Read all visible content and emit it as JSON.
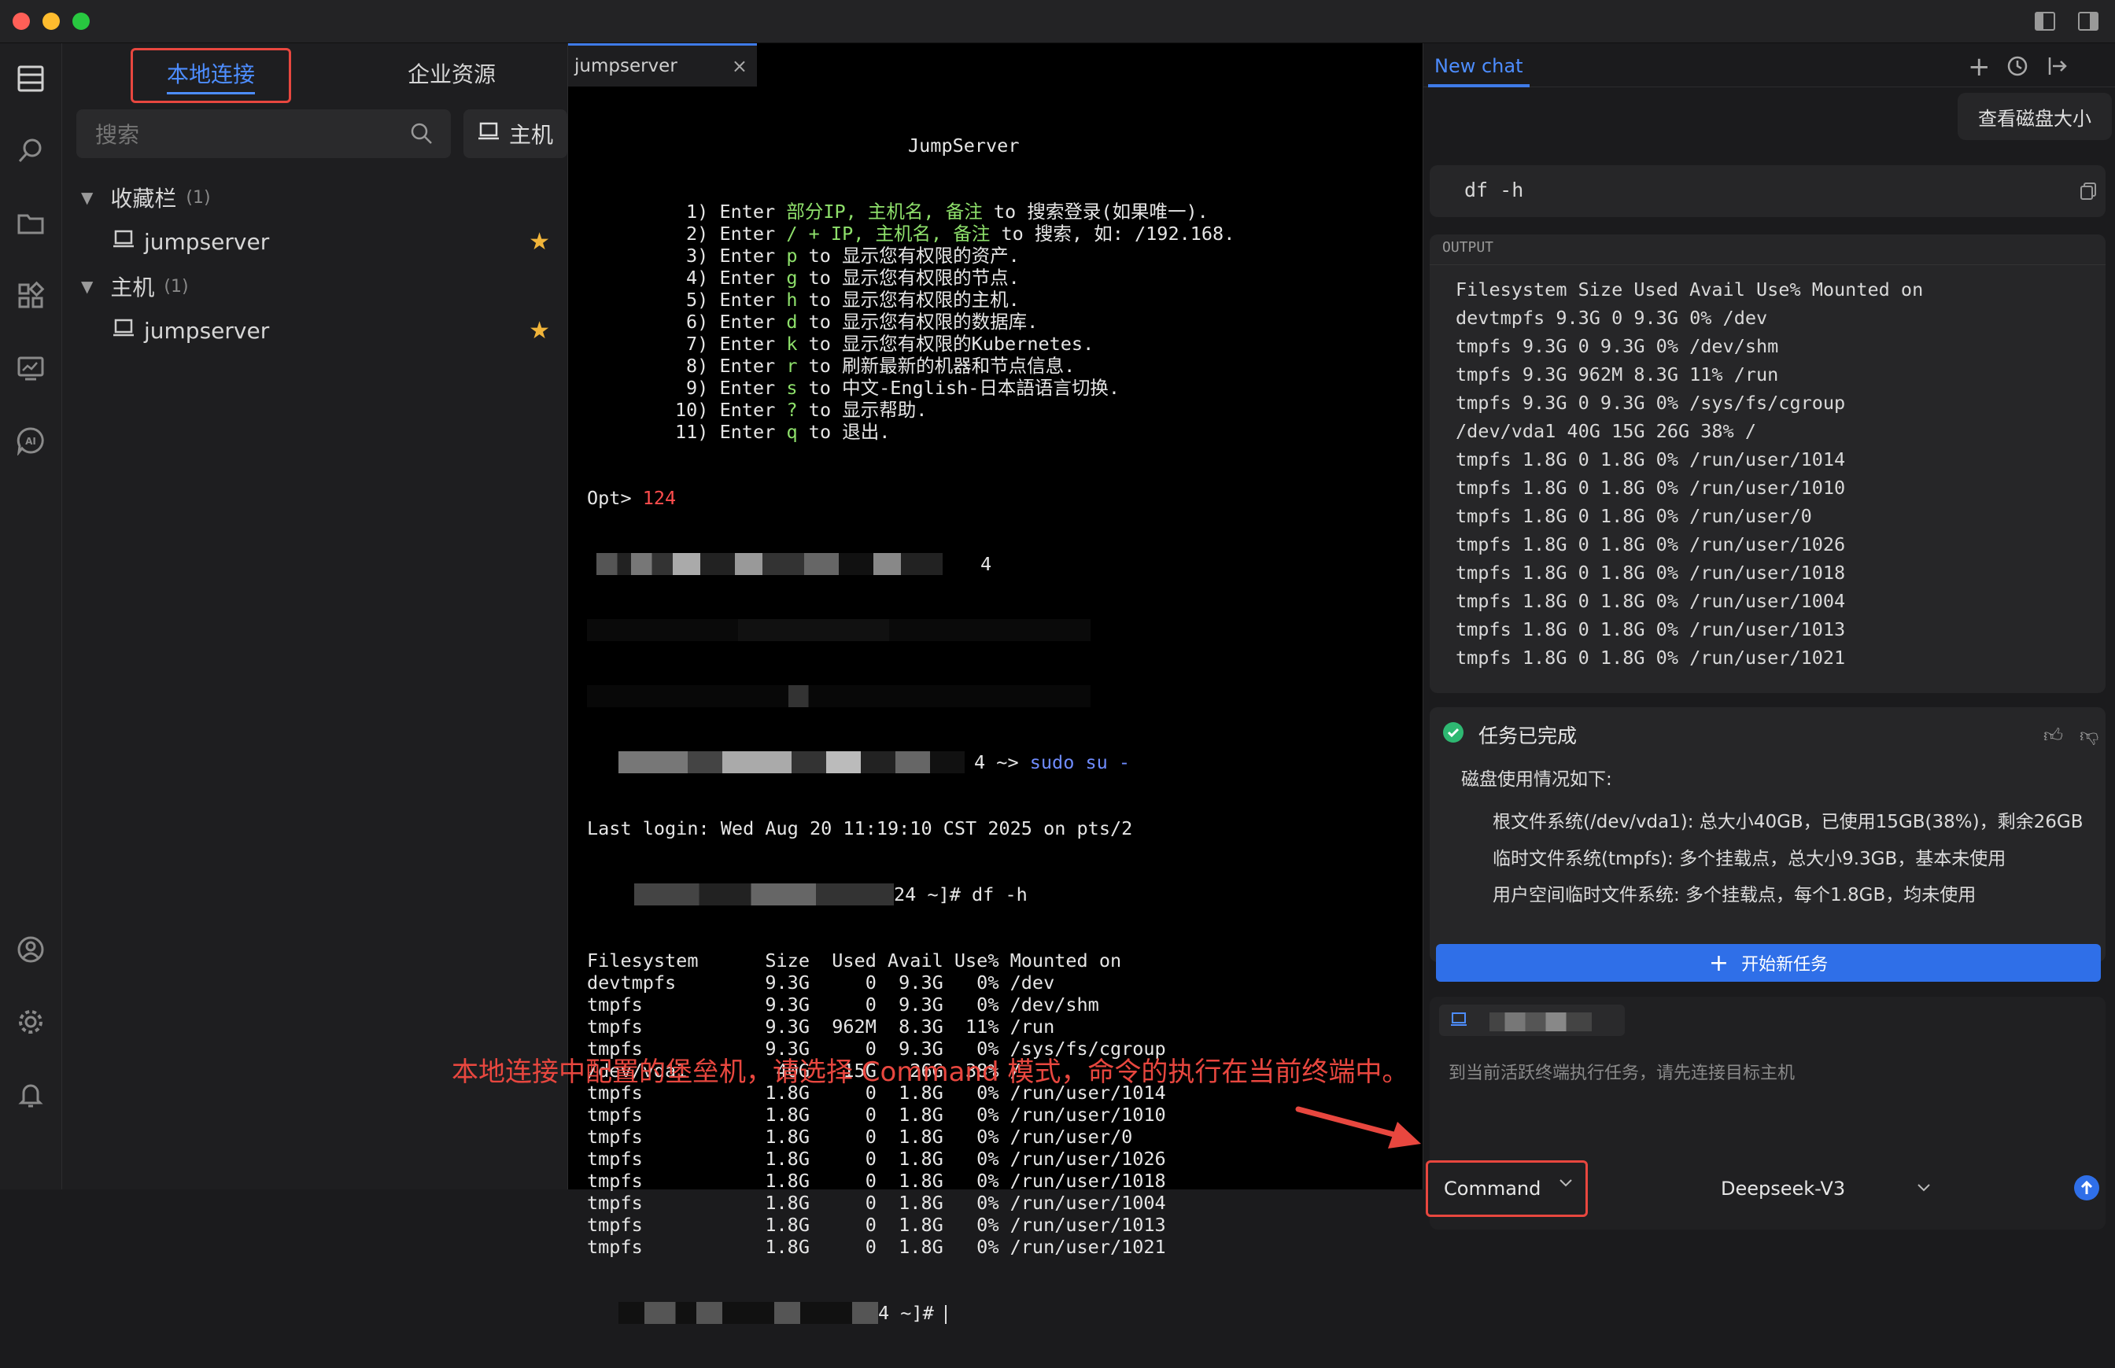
{
  "window": {
    "traffic_lights": [
      "#ff5f57",
      "#febc2e",
      "#28c840"
    ]
  },
  "sidebar": {
    "tabs": [
      {
        "label": "本地连接",
        "active": true
      },
      {
        "label": "企业资源",
        "active": false
      }
    ],
    "search_placeholder": "搜索",
    "host_button_label": "主机",
    "groups": [
      {
        "label": "收藏栏",
        "count": "(1)",
        "items": [
          {
            "label": "jumpserver",
            "starred": true
          }
        ]
      },
      {
        "label": "主机",
        "count": "(1)",
        "items": [
          {
            "label": "jumpserver",
            "starred": true
          }
        ]
      }
    ]
  },
  "terminal": {
    "tab_label": "jumpserver",
    "tab_close": "×",
    "banner_title": "JumpServer",
    "menu": [
      {
        "num": "1)",
        "pre": "Enter ",
        "key": "部分IP, 主机名, 备注",
        "post": " to 搜索登录(如果唯一)."
      },
      {
        "num": "2)",
        "pre": "Enter ",
        "key": "/ + IP, 主机名, 备注",
        "post": " to 搜索, 如: /192.168."
      },
      {
        "num": "3)",
        "pre": "Enter ",
        "key": "p",
        "post": " to 显示您有权限的资产."
      },
      {
        "num": "4)",
        "pre": "Enter ",
        "key": "g",
        "post": " to 显示您有权限的节点."
      },
      {
        "num": "5)",
        "pre": "Enter ",
        "key": "h",
        "post": " to 显示您有权限的主机."
      },
      {
        "num": "6)",
        "pre": "Enter ",
        "key": "d",
        "post": " to 显示您有权限的数据库."
      },
      {
        "num": "7)",
        "pre": "Enter ",
        "key": "k",
        "post": " to 显示您有权限的Kubernetes."
      },
      {
        "num": "8)",
        "pre": "Enter ",
        "key": "r",
        "post": " to 刷新最新的机器和节点信息."
      },
      {
        "num": "9)",
        "pre": "Enter ",
        "key": "s",
        "post": " to 中文-English-日本語语言切换."
      },
      {
        "num": "10)",
        "pre": "Enter ",
        "key": "?",
        "post": " to 显示帮助."
      },
      {
        "num": "11)",
        "pre": "Enter ",
        "key": "q",
        "post": " to 退出."
      }
    ],
    "opt_prompt": "Opt> ",
    "opt_value": "124",
    "blur_suffix_1": "4",
    "prompt_suffix": "4 ~> ",
    "sudo_cmd": "sudo su -",
    "last_login": "Last login: Wed Aug 20 11:19:10 CST 2025 on pts/2",
    "df_prompt": "24 ~]# df -h",
    "df_lines": [
      "Filesystem      Size  Used Avail Use% Mounted on",
      "devtmpfs        9.3G     0  9.3G   0% /dev",
      "tmpfs           9.3G     0  9.3G   0% /dev/shm",
      "tmpfs           9.3G  962M  8.3G  11% /run",
      "tmpfs           9.3G     0  9.3G   0% /sys/fs/cgroup",
      "/dev/vda1        40G   15G   26G  38% /",
      "tmpfs           1.8G     0  1.8G   0% /run/user/1014",
      "tmpfs           1.8G     0  1.8G   0% /run/user/1010",
      "tmpfs           1.8G     0  1.8G   0% /run/user/0",
      "tmpfs           1.8G     0  1.8G   0% /run/user/1026",
      "tmpfs           1.8G     0  1.8G   0% /run/user/1018",
      "tmpfs           1.8G     0  1.8G   0% /run/user/1004",
      "tmpfs           1.8G     0  1.8G   0% /run/user/1013",
      "tmpfs           1.8G     0  1.8G   0% /run/user/1021"
    ],
    "final_prompt": "4 ~]# "
  },
  "chat": {
    "tab_label": "New chat",
    "user_message": "查看磁盘大小",
    "command": "df -h",
    "output_label": "OUTPUT",
    "output_lines": [
      "Filesystem Size Used Avail Use% Mounted on",
      "devtmpfs 9.3G 0 9.3G 0% /dev",
      "tmpfs 9.3G 0 9.3G 0% /dev/shm",
      "tmpfs 9.3G 962M 8.3G 11% /run",
      "tmpfs 9.3G 0 9.3G 0% /sys/fs/cgroup",
      "/dev/vda1 40G 15G 26G 38% /",
      "tmpfs 1.8G 0 1.8G 0% /run/user/1014",
      "tmpfs 1.8G 0 1.8G 0% /run/user/1010",
      "tmpfs 1.8G 0 1.8G 0% /run/user/0",
      "tmpfs 1.8G 0 1.8G 0% /run/user/1026",
      "tmpfs 1.8G 0 1.8G 0% /run/user/1018",
      "tmpfs 1.8G 0 1.8G 0% /run/user/1004",
      "tmpfs 1.8G 0 1.8G 0% /run/user/1013",
      "tmpfs 1.8G 0 1.8G 0% /run/user/1021"
    ],
    "task_status": "任务已完成",
    "summary_title": "磁盘使用情况如下:",
    "summary_items": [
      "根文件系统(/dev/vda1): 总大小40GB，已使用15GB(38%)，剩余26GB",
      "临时文件系统(tmpfs): 多个挂载点，总大小9.3GB，基本未使用",
      "用户空间临时文件系统: 多个挂载点，每个1.8GB，均未使用"
    ],
    "new_task_button": "开始新任务",
    "input_placeholder": "到当前活跃终端执行任务，请先连接目标主机",
    "mode_select": "Command",
    "model_select": "Deepseek-V3"
  },
  "annotation": {
    "text": "本地连接中配置的堡垒机，请选择 Command 模式，命令的执行在当前终端中。",
    "color": "#e8473f"
  },
  "colors": {
    "accent": "#3f7be8",
    "terminal_green": "#8ee06b",
    "terminal_red": "#ff4d4d",
    "success": "#2eb872",
    "star": "#f0b43a"
  }
}
